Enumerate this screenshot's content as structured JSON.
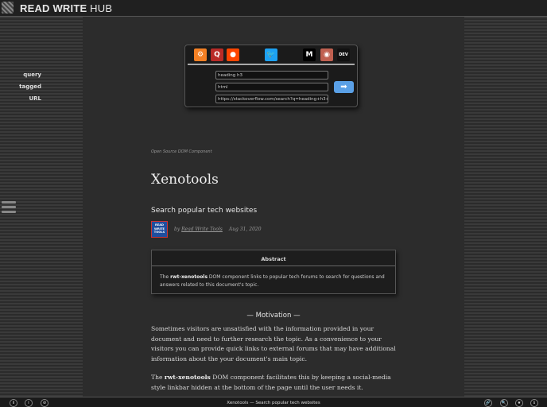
{
  "header": {
    "brand_bold": "READ WRITE",
    "brand_light": " HUB",
    "logo_icon": "rwh-logo-icon"
  },
  "search_panel": {
    "icons": [
      {
        "name": "stackoverflow-icon",
        "glyph": "⚙",
        "color": "#f48024"
      },
      {
        "name": "quora-icon",
        "glyph": "Q",
        "color": "#b92b27"
      },
      {
        "name": "reddit-icon",
        "glyph": "●",
        "color": "#ff4500"
      },
      {
        "name": "twitter-icon",
        "glyph": "🐦",
        "color": "#1da1f2"
      },
      {
        "name": "medium-icon",
        "glyph": "M",
        "color": "#000000"
      },
      {
        "name": "github-icon",
        "glyph": "◉",
        "color": "#c06050"
      },
      {
        "name": "dev-icon",
        "glyph": "DEV",
        "color": "#111111"
      }
    ],
    "query_label": "query",
    "query_value": "heading h3",
    "tagged_label": "tagged",
    "tagged_value": "html",
    "url_label": "URL",
    "url_value": "https://stackoverflow.com/search?q=heading+h3+%5",
    "go_glyph": "➡"
  },
  "article": {
    "kicker": "Open Source DOM Component",
    "title": "Xenotools",
    "subtitle": "Search popular tech websites",
    "author_logo_lines": [
      "READ",
      "WRITE",
      "TOOLS"
    ],
    "by": "by ",
    "author": "Read Write Tools",
    "date": "Aug 31, 2020",
    "abstract_heading": "Abstract",
    "abstract_strong": "rwt-xenotools",
    "abstract_text": " DOM component links to popular tech forums to search for questions and answers related to this document's topic.",
    "abstract_prefix": "The ",
    "section_heading": "— Motivation —",
    "p1": "Sometimes visitors are unsatisfied with the information provided in your document and need to further research the topic. As a convenience to your visitors you can provide quick links to external forums that may have additional information about the your document's main topic.",
    "p2_prefix": "The ",
    "p2_strong": "rwt-xenotools",
    "p2_text": " DOM component facilitates this by keeping a social-media style linkbar hidden at the bottom of the page until the user needs it."
  },
  "footer": {
    "title": "Xenotools — Search popular tech websites",
    "left_buttons": [
      "ii",
      "i",
      "⊘"
    ],
    "right_buttons": [
      "🔗",
      "🔍",
      "★",
      "ℹ"
    ]
  }
}
